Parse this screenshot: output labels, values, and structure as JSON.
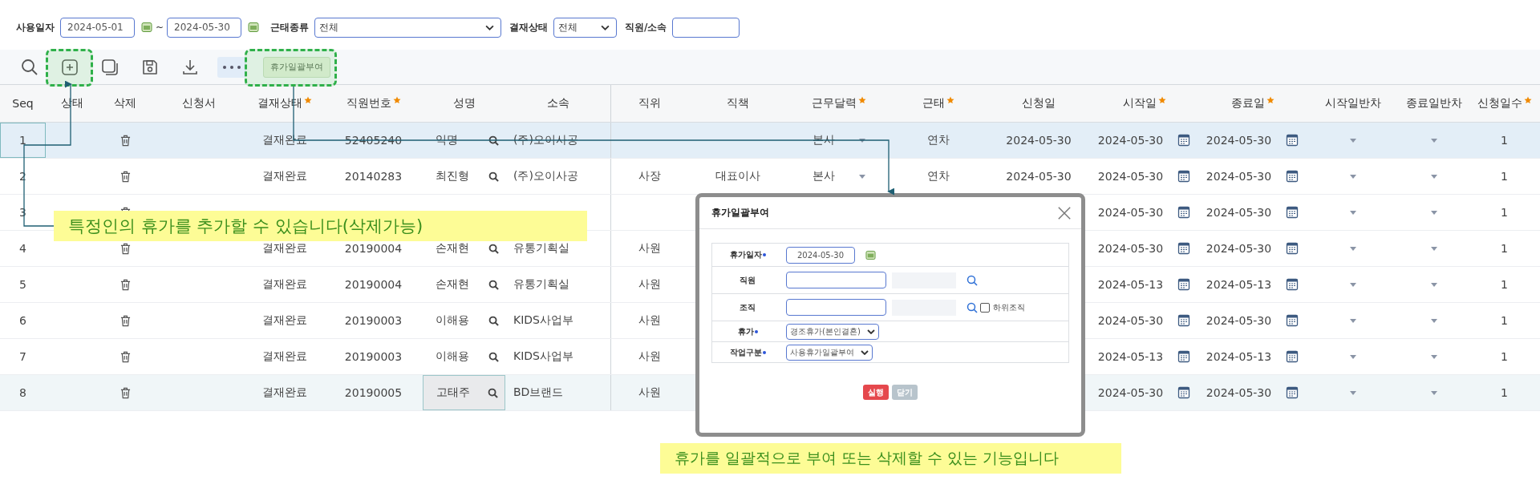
{
  "filters": {
    "date_label": "사용일자",
    "date_from": "2024-05-01",
    "date_sep": "~",
    "date_to": "2024-05-30",
    "type_label": "근태종류",
    "type_value": "전체",
    "approval_label": "결재상태",
    "approval_value": "전체",
    "employee_label": "직원/소속"
  },
  "toolbar": {
    "bulk_button": "휴가일괄부여"
  },
  "table": {
    "columns": [
      {
        "label": "Seq",
        "required": false
      },
      {
        "label": "상태",
        "required": false
      },
      {
        "label": "삭제",
        "required": false
      },
      {
        "label": "신청서",
        "required": false
      },
      {
        "label": "결재상태",
        "required": true
      },
      {
        "label": "직원번호",
        "required": true
      },
      {
        "label": "성명",
        "required": false
      },
      {
        "label": "소속",
        "required": false
      },
      {
        "label": "직위",
        "required": false
      },
      {
        "label": "직책",
        "required": false
      },
      {
        "label": "근무달력",
        "required": true
      },
      {
        "label": "근태",
        "required": true
      },
      {
        "label": "신청일",
        "required": false
      },
      {
        "label": "시작일",
        "required": true
      },
      {
        "label": "종료일",
        "required": true
      },
      {
        "label": "시작일반차",
        "required": false
      },
      {
        "label": "종료일반차",
        "required": false
      },
      {
        "label": "신청일수",
        "required": true
      }
    ],
    "rows": [
      {
        "seq": "1",
        "approval": "결재완료",
        "emp_no": "52405240",
        "name": "익명",
        "dept": "(주)오이사공",
        "calendar": "본사",
        "attendance": "연차",
        "request_date": "2024-05-30",
        "start_date": "2024-05-30",
        "end_date": "2024-05-30",
        "days": "1",
        "selected": true,
        "hovered": false
      },
      {
        "seq": "2",
        "approval": "결재완료",
        "emp_no": "20140283",
        "name": "최진형",
        "dept": "(주)오이사공",
        "position": "사장",
        "title": "대표이사",
        "calendar": "본사",
        "attendance": "연차",
        "request_date": "2024-05-30",
        "start_date": "2024-05-30",
        "end_date": "2024-05-30",
        "days": "1",
        "selected": false,
        "hovered": false
      },
      {
        "seq": "3",
        "start_date": "2024-05-30",
        "end_date": "2024-05-30",
        "days": "1",
        "selected": false,
        "hovered": false
      },
      {
        "seq": "4",
        "approval": "결재완료",
        "emp_no": "20190004",
        "name": "손재현",
        "dept": "유통기획실",
        "position": "사원",
        "start_date": "2024-05-30",
        "end_date": "2024-05-30",
        "days": "1",
        "selected": false,
        "hovered": false
      },
      {
        "seq": "5",
        "approval": "결재완료",
        "emp_no": "20190004",
        "name": "손재현",
        "dept": "유통기획실",
        "position": "사원",
        "start_date": "2024-05-13",
        "end_date": "2024-05-13",
        "days": "1",
        "selected": false,
        "hovered": false
      },
      {
        "seq": "6",
        "approval": "결재완료",
        "emp_no": "20190003",
        "name": "이해용",
        "dept": "KIDS사업부",
        "position": "사원",
        "start_date": "2024-05-30",
        "end_date": "2024-05-30",
        "days": "1",
        "selected": false,
        "hovered": false
      },
      {
        "seq": "7",
        "approval": "결재완료",
        "emp_no": "20190003",
        "name": "이해용",
        "dept": "KIDS사업부",
        "position": "사원",
        "start_date": "2024-05-13",
        "end_date": "2024-05-13",
        "days": "1",
        "selected": false,
        "hovered": false
      },
      {
        "seq": "8",
        "approval": "결재완료",
        "emp_no": "20190005",
        "name": "고태주",
        "dept": "BD브랜드",
        "position": "사원",
        "start_date": "2024-05-30",
        "end_date": "2024-05-30",
        "days": "1",
        "selected": false,
        "hovered": true
      }
    ]
  },
  "dialog": {
    "title": "휴가일괄부여",
    "fields": [
      {
        "kind": "date",
        "label": "휴가일자",
        "required": true,
        "value": "2024-05-30"
      },
      {
        "kind": "lookup",
        "label": "직원",
        "required": false
      },
      {
        "kind": "lookup",
        "label": "조직",
        "required": false,
        "checkbox": {
          "label": "하위조직",
          "checked": false
        }
      },
      {
        "kind": "select",
        "label": "휴가",
        "required": true,
        "value": "경조휴가(본인결혼)"
      },
      {
        "kind": "select",
        "label": "작업구분",
        "required": true,
        "value": "사용휴가일괄부여"
      }
    ],
    "buttons": [
      {
        "label": "실행",
        "kind": "primary"
      },
      {
        "label": "닫기",
        "kind": "secondary"
      }
    ]
  },
  "notes": [
    {
      "text": "특정인의 휴가를 추가할 수 있습니다(삭제가능)"
    },
    {
      "text": "휴가를 일괄적으로 부여 또는 삭제할 수 있는 기능입니다"
    }
  ]
}
